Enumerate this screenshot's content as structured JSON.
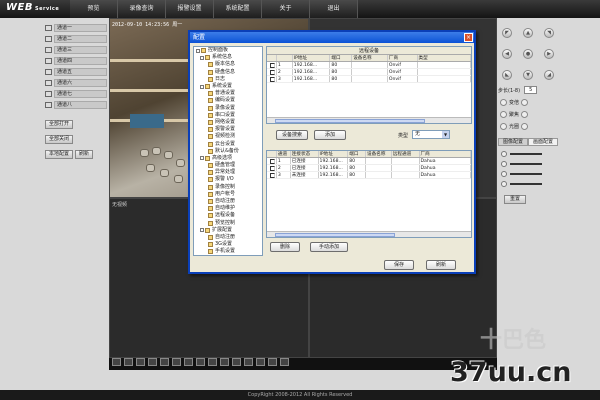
{
  "app": {
    "logo": "WEB",
    "logo_sub": "Service",
    "nav": [
      "预览",
      "录像查询",
      "报警设置",
      "系统配置",
      "关于",
      "退出"
    ]
  },
  "left_panel": {
    "channels": [
      "通道一",
      "通道二",
      "通道三",
      "通道四",
      "通道五",
      "通道六",
      "通道七",
      "通道八"
    ],
    "buttons": [
      "全部打开",
      "全部关闭",
      "本地配置",
      "刷新"
    ]
  },
  "video": {
    "osd": "2012-09-10 14:23:56 周一",
    "sub_label": "无视频"
  },
  "right_panel": {
    "ptz_center": "●",
    "step_label": "步长(1-8)",
    "step_value": "5",
    "rows": [
      "变倍",
      "聚焦",
      "光圈"
    ],
    "tabs": [
      "图像配置",
      "画面配置"
    ],
    "reset": "重置"
  },
  "dialog": {
    "title": "配置",
    "close": "×",
    "tree": [
      {
        "label": "控制面板",
        "level": 0
      },
      {
        "label": "系统信息",
        "level": 1
      },
      {
        "label": "版本信息",
        "level": 2
      },
      {
        "label": "硬盘信息",
        "level": 2
      },
      {
        "label": "日志",
        "level": 2
      },
      {
        "label": "系统设置",
        "level": 1
      },
      {
        "label": "普通设置",
        "level": 2
      },
      {
        "label": "编码设置",
        "level": 2
      },
      {
        "label": "录像设置",
        "level": 2
      },
      {
        "label": "串口设置",
        "level": 2
      },
      {
        "label": "网络设置",
        "level": 2
      },
      {
        "label": "报警设置",
        "level": 2
      },
      {
        "label": "视频检测",
        "level": 2
      },
      {
        "label": "云台设置",
        "level": 2
      },
      {
        "label": "默认&备份",
        "level": 2
      },
      {
        "label": "高级选项",
        "level": 1
      },
      {
        "label": "硬盘管理",
        "level": 2
      },
      {
        "label": "异常处理",
        "level": 2
      },
      {
        "label": "报警 I/O",
        "level": 2
      },
      {
        "label": "录像控制",
        "level": 2
      },
      {
        "label": "用户帐号",
        "level": 2
      },
      {
        "label": "自动注册",
        "level": 2
      },
      {
        "label": "自动维护",
        "level": 2
      },
      {
        "label": "远程设备",
        "level": 2
      },
      {
        "label": "预览控制",
        "level": 2
      },
      {
        "label": "扩展配置",
        "level": 1
      },
      {
        "label": "自动注册",
        "level": 2
      },
      {
        "label": "3G设置",
        "level": 2
      },
      {
        "label": "手机设置",
        "level": 2
      },
      {
        "label": "NTP设置",
        "level": 2
      }
    ],
    "online": {
      "title": "远程设备",
      "headers": [
        "",
        "",
        "IP地址",
        "端口",
        "设备名称",
        "厂商",
        "类型"
      ],
      "rows": [
        [
          "1",
          "192.168...",
          "80",
          "",
          "Onvif",
          ""
        ],
        [
          "2",
          "192.168...",
          "80",
          "",
          "Onvif",
          ""
        ],
        [
          "3",
          "192.168...",
          "80",
          "",
          "Onvif",
          ""
        ]
      ]
    },
    "search_btn": "设备搜索",
    "add_btn": "添加",
    "type_label": "类型",
    "type_value": "无",
    "added": {
      "headers": [
        "",
        "通道",
        "连接状态",
        "IP地址",
        "端口",
        "设备名称",
        "远程通道",
        "厂商"
      ],
      "rows": [
        [
          "1",
          "已连接",
          "192.168...",
          "80",
          "",
          "",
          "Dahua"
        ],
        [
          "2",
          "已连接",
          "192.168...",
          "80",
          "",
          "",
          "Dahua"
        ],
        [
          "3",
          "未连接",
          "192.168...",
          "80",
          "",
          "",
          "Dahua"
        ]
      ]
    },
    "delete_btn": "删除",
    "manual_add_btn": "手动添加",
    "save_btn": "保存",
    "refresh_btn": "刷新"
  },
  "footer": "CopyRight 2008-2012 All Rights Reserved",
  "watermark": "37uu.cn",
  "watermark_bg": "十巴色"
}
